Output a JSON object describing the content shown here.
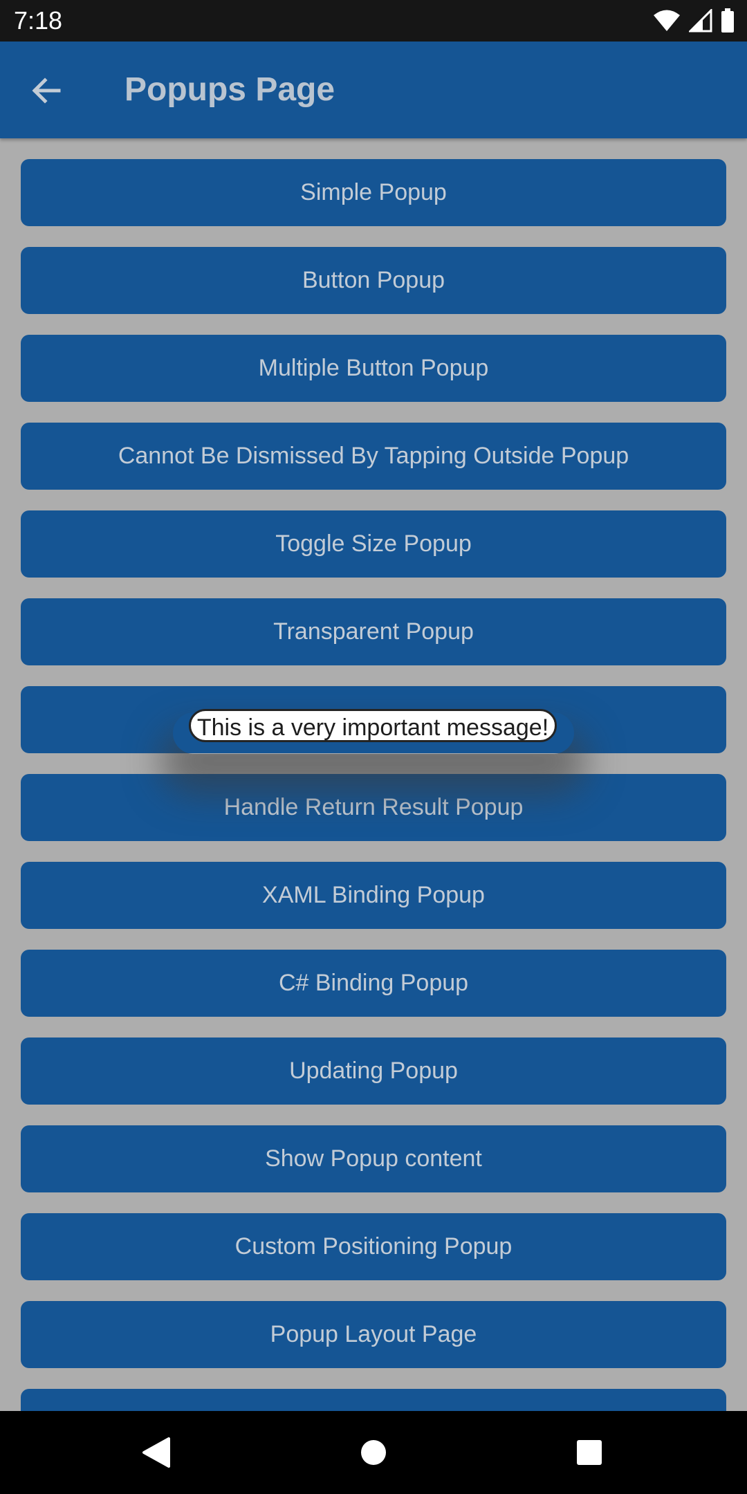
{
  "status_bar": {
    "time": "7:18",
    "icons": [
      "wifi-icon",
      "signal-icon",
      "battery-icon"
    ]
  },
  "app_bar": {
    "title": "Popups Page",
    "back_icon": "arrow-left-icon"
  },
  "colors": {
    "primary": "#155594",
    "background": "#adadad",
    "button_text": "#c3ccd6"
  },
  "buttons": [
    "Simple Popup",
    "Button Popup",
    "Multiple Button Popup",
    "Cannot Be Dismissed By Tapping Outside Popup",
    "Toggle Size Popup",
    "Transparent Popup",
    "",
    "Handle Return Result Popup",
    "XAML Binding Popup",
    "C# Binding Popup",
    "Updating Popup",
    "Show Popup content",
    "Custom Positioning Popup",
    "Popup Layout Page",
    ""
  ],
  "toast": {
    "message": "This is a very important message!"
  },
  "nav_bar": {
    "icons": [
      "back-triangle-icon",
      "home-circle-icon",
      "recents-square-icon"
    ]
  }
}
